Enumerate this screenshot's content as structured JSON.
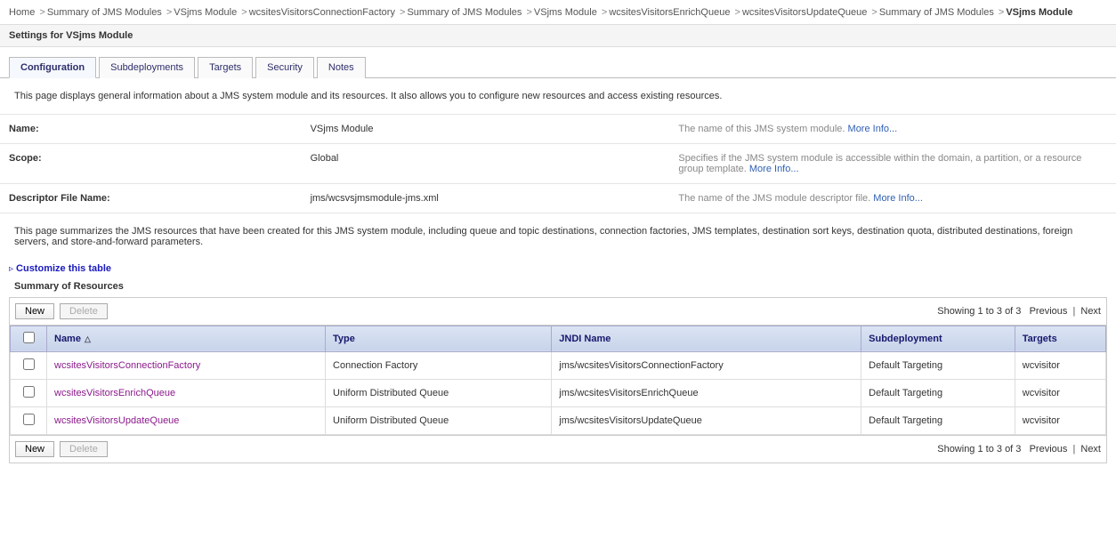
{
  "breadcrumb": [
    {
      "label": "Home",
      "current": false
    },
    {
      "label": "Summary of JMS Modules",
      "current": false
    },
    {
      "label": "VSjms Module",
      "current": false
    },
    {
      "label": "wcsitesVisitorsConnectionFactory",
      "current": false
    },
    {
      "label": "Summary of JMS Modules",
      "current": false
    },
    {
      "label": "VSjms Module",
      "current": false
    },
    {
      "label": "wcsitesVisitorsEnrichQueue",
      "current": false
    },
    {
      "label": "wcsitesVisitorsUpdateQueue",
      "current": false
    },
    {
      "label": "Summary of JMS Modules",
      "current": false
    },
    {
      "label": "VSjms Module",
      "current": true
    }
  ],
  "settings_title": "Settings for VSjms Module",
  "tabs": [
    {
      "label": "Configuration",
      "active": true
    },
    {
      "label": "Subdeployments",
      "active": false
    },
    {
      "label": "Targets",
      "active": false
    },
    {
      "label": "Security",
      "active": false
    },
    {
      "label": "Notes",
      "active": false
    }
  ],
  "page_description": "This page displays general information about a JMS system module and its resources. It also allows you to configure new resources and access existing resources.",
  "properties": [
    {
      "label": "Name:",
      "value": "VSjms Module",
      "help": "The name of this JMS system module.",
      "more": "More Info..."
    },
    {
      "label": "Scope:",
      "value": "Global",
      "help": "Specifies if the JMS system module is accessible within the domain, a partition, or a resource group template.",
      "more": "More Info..."
    },
    {
      "label": "Descriptor File Name:",
      "value": "jms/wcsvsjmsmodule-jms.xml",
      "help": "The name of the JMS module descriptor file.",
      "more": "More Info..."
    }
  ],
  "summary_description": "This page summarizes the JMS resources that have been created for this JMS system module, including queue and topic destinations, connection factories, JMS templates, destination sort keys, destination quota, distributed destinations, foreign servers, and store-and-forward parameters.",
  "customize_label": "Customize this table",
  "table_title": "Summary of Resources",
  "buttons": {
    "new": "New",
    "delete": "Delete"
  },
  "pagination": {
    "showing": "Showing 1 to 3 of 3",
    "prev": "Previous",
    "next": "Next"
  },
  "columns": {
    "name": "Name",
    "type": "Type",
    "jndi": "JNDI Name",
    "subdep": "Subdeployment",
    "targets": "Targets"
  },
  "rows": [
    {
      "name": "wcsitesVisitorsConnectionFactory",
      "type": "Connection Factory",
      "jndi": "jms/wcsitesVisitorsConnectionFactory",
      "subdep": "Default Targeting",
      "targets": "wcvisitor"
    },
    {
      "name": "wcsitesVisitorsEnrichQueue",
      "type": "Uniform Distributed Queue",
      "jndi": "jms/wcsitesVisitorsEnrichQueue",
      "subdep": "Default Targeting",
      "targets": "wcvisitor"
    },
    {
      "name": "wcsitesVisitorsUpdateQueue",
      "type": "Uniform Distributed Queue",
      "jndi": "jms/wcsitesVisitorsUpdateQueue",
      "subdep": "Default Targeting",
      "targets": "wcvisitor"
    }
  ]
}
